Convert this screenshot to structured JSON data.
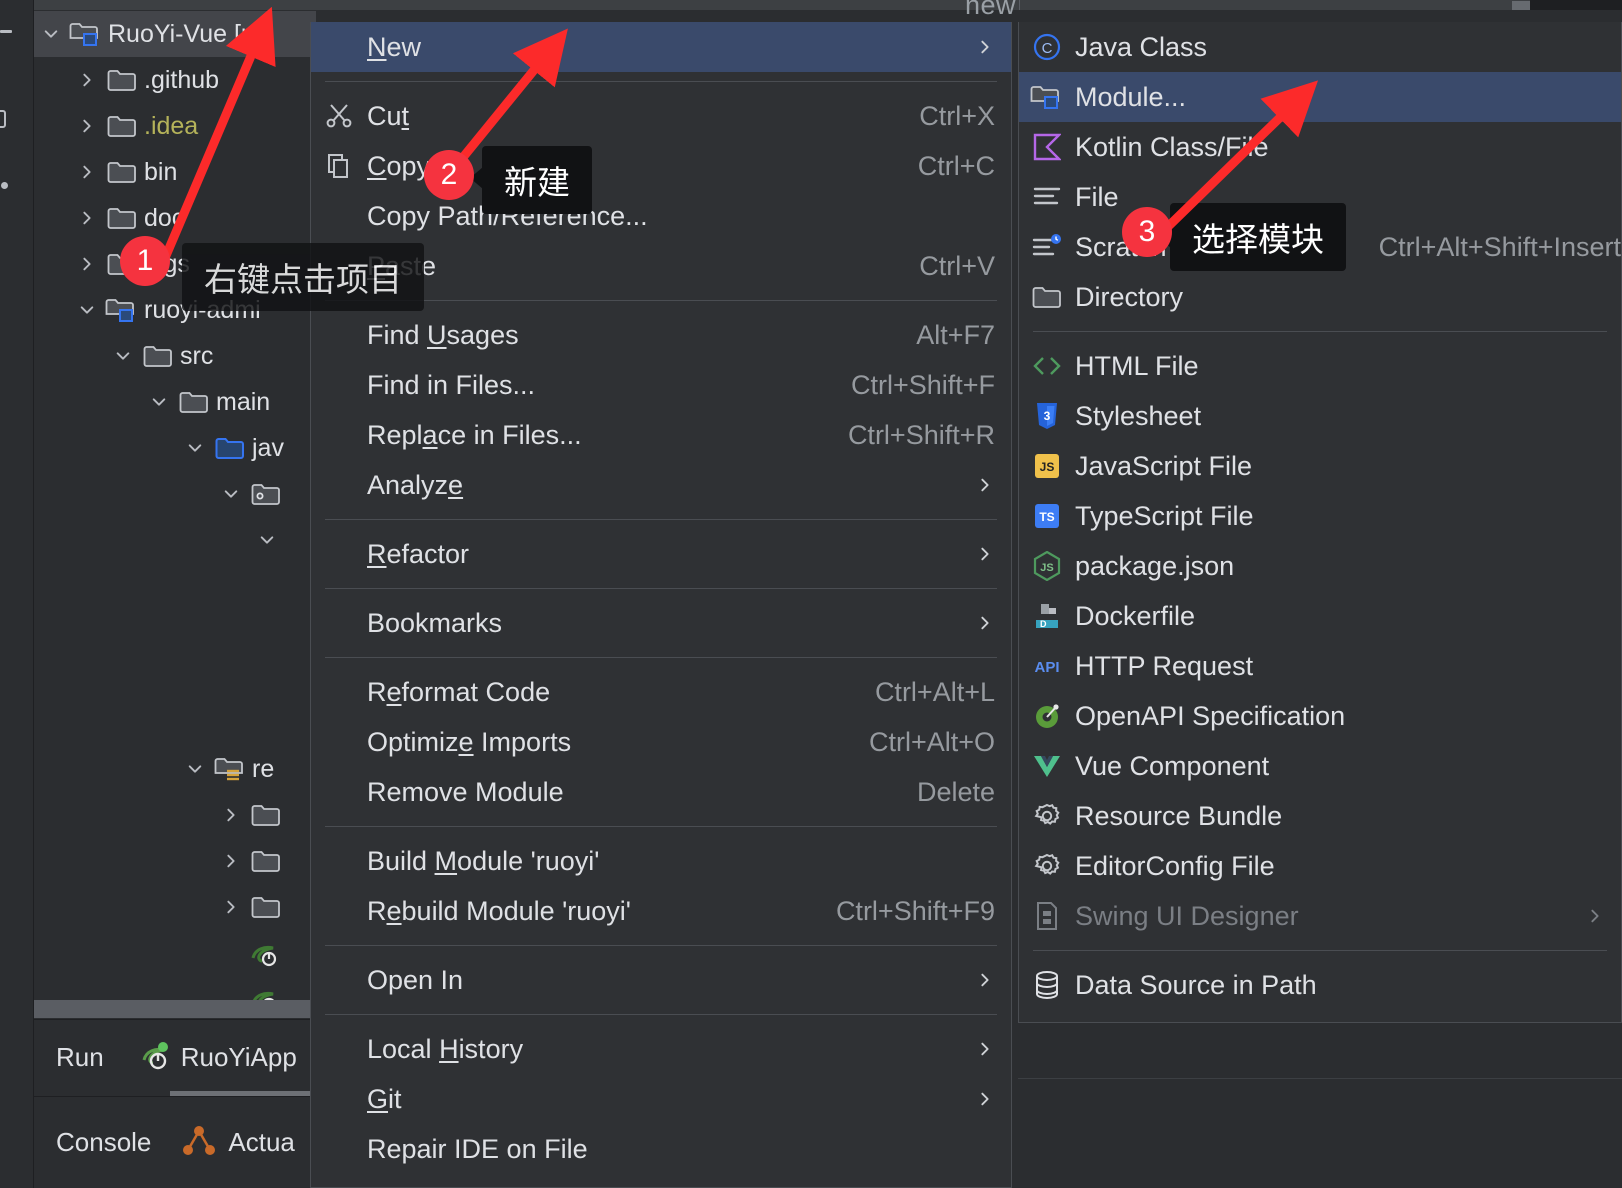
{
  "window": {
    "background": "#2b2d30",
    "accent_highlight": "#3a4a6b",
    "annotation_color": "#f5333f",
    "top_fragment_text": "new"
  },
  "project_tree": {
    "rows": [
      {
        "label": "RuoYi-Vue [ru",
        "icon": "module-folder-icon",
        "twisty": "chevron-down-icon",
        "indent": 0,
        "selected": true,
        "color": "normal"
      },
      {
        "label": ".github",
        "icon": "folder-icon",
        "twisty": "chevron-right-icon",
        "indent": 1,
        "selected": false,
        "color": "normal"
      },
      {
        "label": ".idea",
        "icon": "folder-icon",
        "twisty": "chevron-right-icon",
        "indent": 1,
        "selected": false,
        "color": "yellow"
      },
      {
        "label": "bin",
        "icon": "folder-icon",
        "twisty": "chevron-right-icon",
        "indent": 1,
        "selected": false,
        "color": "normal"
      },
      {
        "label": "doc",
        "icon": "folder-icon",
        "twisty": "chevron-right-icon",
        "indent": 1,
        "selected": false,
        "color": "normal"
      },
      {
        "label": "logs",
        "icon": "folder-icon",
        "twisty": "chevron-right-icon",
        "indent": 1,
        "selected": false,
        "color": "normal"
      },
      {
        "label": "ruoyi-admi",
        "icon": "module-folder-icon",
        "twisty": "chevron-down-icon",
        "indent": 1,
        "selected": false,
        "color": "normal"
      },
      {
        "label": "src",
        "icon": "folder-icon",
        "twisty": "chevron-down-icon",
        "indent": 2,
        "selected": false,
        "color": "normal"
      },
      {
        "label": "main",
        "icon": "folder-icon",
        "twisty": "chevron-down-icon",
        "indent": 3,
        "selected": false,
        "color": "normal"
      },
      {
        "label": "jav",
        "icon": "source-folder-icon",
        "twisty": "chevron-down-icon",
        "indent": 4,
        "selected": false,
        "color": "normal"
      },
      {
        "label": "",
        "icon": "package-folder-icon",
        "twisty": "chevron-down-icon",
        "indent": 5,
        "selected": false,
        "color": "normal"
      },
      {
        "label": "",
        "icon": "none",
        "twisty": "chevron-down-icon",
        "indent": 6,
        "selected": false,
        "color": "normal"
      }
    ],
    "lower_rows": [
      {
        "label": "re",
        "icon": "resources-folder-icon",
        "twisty": "chevron-down-icon",
        "indent": 4
      },
      {
        "label": "",
        "icon": "folder-icon",
        "twisty": "chevron-right-icon",
        "indent": 5
      },
      {
        "label": "",
        "icon": "folder-icon",
        "twisty": "chevron-right-icon",
        "indent": 5
      },
      {
        "label": "",
        "icon": "folder-icon",
        "twisty": "chevron-right-icon",
        "indent": 5
      },
      {
        "label": "",
        "icon": "spring-bean-icon",
        "twisty": "none",
        "indent": 5
      },
      {
        "label": "",
        "icon": "spring-bean-icon",
        "twisty": "none",
        "indent": 5
      }
    ]
  },
  "bottom_bars": {
    "run_label": "Run",
    "run_config_name": "RuoYiApp",
    "run_config_icon": "spring-boot-run-icon",
    "console_label": "Console",
    "console_tab_name": "Actua",
    "console_tab_icon": "actuator-icon"
  },
  "context_menu": {
    "items": [
      {
        "type": "item",
        "label": "New",
        "underline_index": 0,
        "shortcut": "",
        "submenu": true,
        "highlighted": true,
        "icon": "none"
      },
      {
        "type": "separator"
      },
      {
        "type": "item",
        "label": "Cut",
        "underline_index": 2,
        "shortcut": "Ctrl+X",
        "submenu": false,
        "highlighted": false,
        "icon": "scissors-icon"
      },
      {
        "type": "item",
        "label": "Copy",
        "underline_index": 0,
        "shortcut": "Ctrl+C",
        "submenu": false,
        "highlighted": false,
        "icon": "copy-icon"
      },
      {
        "type": "item",
        "label": "Copy Path/Reference...",
        "underline_index": -1,
        "shortcut": "",
        "submenu": false,
        "highlighted": false,
        "icon": "none"
      },
      {
        "type": "item",
        "label": "Paste",
        "underline_index": 0,
        "shortcut": "Ctrl+V",
        "submenu": false,
        "highlighted": false,
        "icon": "none"
      },
      {
        "type": "separator"
      },
      {
        "type": "item",
        "label": "Find Usages",
        "underline_index": 5,
        "shortcut": "Alt+F7",
        "submenu": false,
        "highlighted": false,
        "icon": "none"
      },
      {
        "type": "item",
        "label": "Find in Files...",
        "underline_index": -1,
        "shortcut": "Ctrl+Shift+F",
        "submenu": false,
        "highlighted": false,
        "icon": "none"
      },
      {
        "type": "item",
        "label": "Replace in Files...",
        "underline_index": 4,
        "shortcut": "Ctrl+Shift+R",
        "submenu": false,
        "highlighted": false,
        "icon": "none"
      },
      {
        "type": "item",
        "label": "Analyze",
        "underline_index": 6,
        "shortcut": "",
        "submenu": true,
        "highlighted": false,
        "icon": "none"
      },
      {
        "type": "separator"
      },
      {
        "type": "item",
        "label": "Refactor",
        "underline_index": 0,
        "shortcut": "",
        "submenu": true,
        "highlighted": false,
        "icon": "none"
      },
      {
        "type": "separator"
      },
      {
        "type": "item",
        "label": "Bookmarks",
        "underline_index": -1,
        "shortcut": "",
        "submenu": true,
        "highlighted": false,
        "icon": "none"
      },
      {
        "type": "separator"
      },
      {
        "type": "item",
        "label": "Reformat Code",
        "underline_index": 1,
        "shortcut": "Ctrl+Alt+L",
        "submenu": false,
        "highlighted": false,
        "icon": "none"
      },
      {
        "type": "item",
        "label": "Optimize Imports",
        "underline_index": 7,
        "shortcut": "Ctrl+Alt+O",
        "submenu": false,
        "highlighted": false,
        "icon": "none"
      },
      {
        "type": "item",
        "label": "Remove Module",
        "underline_index": -1,
        "shortcut": "Delete",
        "submenu": false,
        "highlighted": false,
        "icon": "none"
      },
      {
        "type": "separator"
      },
      {
        "type": "item",
        "label": "Build Module 'ruoyi'",
        "underline_index": 6,
        "shortcut": "",
        "submenu": false,
        "highlighted": false,
        "icon": "none"
      },
      {
        "type": "item",
        "label": "Rebuild Module 'ruoyi'",
        "underline_index": 1,
        "shortcut": "Ctrl+Shift+F9",
        "submenu": false,
        "highlighted": false,
        "icon": "none"
      },
      {
        "type": "separator"
      },
      {
        "type": "item",
        "label": "Open In",
        "underline_index": -1,
        "shortcut": "",
        "submenu": true,
        "highlighted": false,
        "icon": "none"
      },
      {
        "type": "separator"
      },
      {
        "type": "item",
        "label": "Local History",
        "underline_index": 6,
        "shortcut": "",
        "submenu": true,
        "highlighted": false,
        "icon": "none"
      },
      {
        "type": "item",
        "label": "Git",
        "underline_index": 0,
        "shortcut": "",
        "submenu": true,
        "highlighted": false,
        "icon": "none"
      },
      {
        "type": "item",
        "label": "Repair IDE on File",
        "underline_index": -1,
        "shortcut": "",
        "submenu": false,
        "highlighted": false,
        "icon": "none"
      }
    ]
  },
  "new_submenu": {
    "items": [
      {
        "type": "item",
        "label": "Java Class",
        "icon": "java-class-icon",
        "shortcut": "",
        "submenu": false,
        "highlighted": false,
        "disabled": false
      },
      {
        "type": "item",
        "label": "Module...",
        "icon": "module-folder-icon",
        "shortcut": "",
        "submenu": false,
        "highlighted": true,
        "disabled": false
      },
      {
        "type": "item",
        "label": "Kotlin Class/File",
        "icon": "kotlin-icon",
        "shortcut": "",
        "submenu": false,
        "highlighted": false,
        "disabled": false
      },
      {
        "type": "item",
        "label": "File",
        "icon": "file-lines-icon",
        "shortcut": "",
        "submenu": false,
        "highlighted": false,
        "disabled": false
      },
      {
        "type": "item",
        "label": "Scratch File",
        "icon": "scratch-file-icon",
        "shortcut": "Ctrl+Alt+Shift+Insert",
        "submenu": false,
        "highlighted": false,
        "disabled": false
      },
      {
        "type": "item",
        "label": "Directory",
        "icon": "folder-icon",
        "shortcut": "",
        "submenu": false,
        "highlighted": false,
        "disabled": false
      },
      {
        "type": "separator"
      },
      {
        "type": "item",
        "label": "HTML File",
        "icon": "html-icon",
        "shortcut": "",
        "submenu": false,
        "highlighted": false,
        "disabled": false
      },
      {
        "type": "item",
        "label": "Stylesheet",
        "icon": "css-icon",
        "shortcut": "",
        "submenu": false,
        "highlighted": false,
        "disabled": false
      },
      {
        "type": "item",
        "label": "JavaScript File",
        "icon": "js-icon",
        "shortcut": "",
        "submenu": false,
        "highlighted": false,
        "disabled": false
      },
      {
        "type": "item",
        "label": "TypeScript File",
        "icon": "ts-icon",
        "shortcut": "",
        "submenu": false,
        "highlighted": false,
        "disabled": false
      },
      {
        "type": "item",
        "label": "package.json",
        "icon": "nodejs-icon",
        "shortcut": "",
        "submenu": false,
        "highlighted": false,
        "disabled": false
      },
      {
        "type": "item",
        "label": "Dockerfile",
        "icon": "docker-icon",
        "shortcut": "",
        "submenu": false,
        "highlighted": false,
        "disabled": false
      },
      {
        "type": "item",
        "label": "HTTP Request",
        "icon": "api-icon",
        "shortcut": "",
        "submenu": false,
        "highlighted": false,
        "disabled": false
      },
      {
        "type": "item",
        "label": "OpenAPI Specification",
        "icon": "openapi-icon",
        "shortcut": "",
        "submenu": false,
        "highlighted": false,
        "disabled": false
      },
      {
        "type": "item",
        "label": "Vue Component",
        "icon": "vue-icon",
        "shortcut": "",
        "submenu": false,
        "highlighted": false,
        "disabled": false
      },
      {
        "type": "item",
        "label": "Resource Bundle",
        "icon": "gear-icon",
        "shortcut": "",
        "submenu": false,
        "highlighted": false,
        "disabled": false
      },
      {
        "type": "item",
        "label": "EditorConfig File",
        "icon": "gear-icon",
        "shortcut": "",
        "submenu": false,
        "highlighted": false,
        "disabled": false
      },
      {
        "type": "item",
        "label": "Swing UI Designer",
        "icon": "swing-icon",
        "shortcut": "",
        "submenu": true,
        "highlighted": false,
        "disabled": true
      },
      {
        "type": "separator"
      },
      {
        "type": "item",
        "label": "Data Source in Path",
        "icon": "database-icon",
        "shortcut": "",
        "submenu": false,
        "highlighted": false,
        "disabled": false
      }
    ]
  },
  "annotations": [
    {
      "number": "1",
      "tooltip": "右键点击项目",
      "target": "project-root-node"
    },
    {
      "number": "2",
      "tooltip": "新建",
      "target": "context-menu-new"
    },
    {
      "number": "3",
      "tooltip": "选择模块",
      "target": "submenu-module"
    }
  ]
}
